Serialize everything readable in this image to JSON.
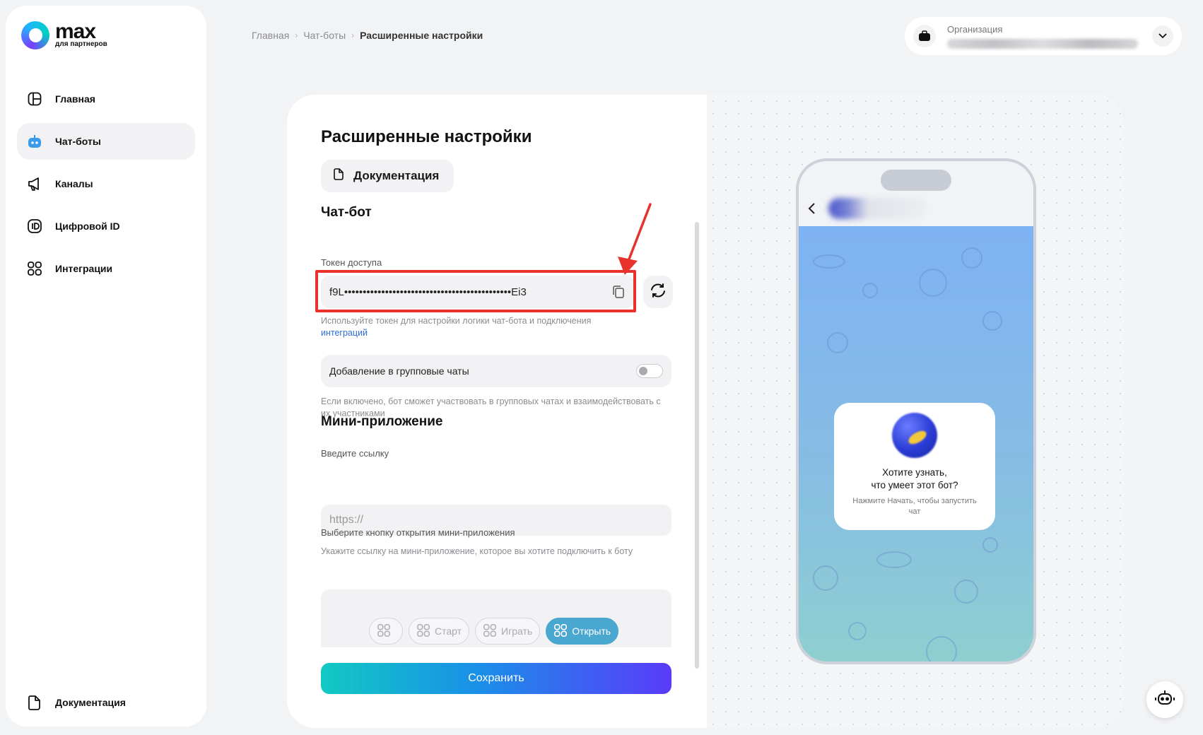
{
  "brand": {
    "name": "max",
    "subtitle": "для партнеров"
  },
  "sidebar": {
    "items": [
      {
        "label": "Главная",
        "icon": "dashboard-icon"
      },
      {
        "label": "Чат-боты",
        "icon": "bot-icon",
        "active": true
      },
      {
        "label": "Каналы",
        "icon": "megaphone-icon"
      },
      {
        "label": "Цифровой ID",
        "icon": "id-icon"
      },
      {
        "label": "Интеграции",
        "icon": "grid-icon"
      }
    ],
    "bottom_item": {
      "label": "Документация",
      "icon": "document-icon"
    }
  },
  "breadcrumb": {
    "items": [
      "Главная",
      "Чат-боты"
    ],
    "current": "Расширенные настройки"
  },
  "organization": {
    "label": "Организация"
  },
  "page": {
    "title": "Расширенные настройки",
    "doc_button": "Документация",
    "chatbot_section": "Чат-бот",
    "token_label": "Токен доступа",
    "token_value": "f9L•••••••••••••••••••••••••••••••••••••••••••••Ei3",
    "token_hint": "Используйте токен для настройки логики чат-бота и подключения",
    "token_hint_link": "интеграций",
    "group_toggle_label": "Добавление в групповые чаты",
    "group_toggle_on": false,
    "group_hint": "Если включено, бот сможет участвовать в групповых чатах и взаимодействовать с их участниками",
    "miniapp_section": "Мини-приложение",
    "url_label": "Введите ссылку",
    "url_placeholder": "https://",
    "url_hint": "Укажите ссылку на мини-приложение, которое вы хотите подключить к боту",
    "button_select_label": "Выберите кнопку открытия мини-приложения",
    "button_options": [
      "",
      "Старт",
      "Играть",
      "Открыть"
    ],
    "selected_option": "Открыть",
    "save_button": "Сохранить"
  },
  "preview": {
    "bubble_title_1": "Хотите узнать,",
    "bubble_title_2": "что умеет этот бот?",
    "bubble_sub": "Нажмите Начать, чтобы запустить чат"
  },
  "colors": {
    "accent": "#4aa7cf",
    "highlight": "#e8322c",
    "link": "#2c6ed8"
  }
}
